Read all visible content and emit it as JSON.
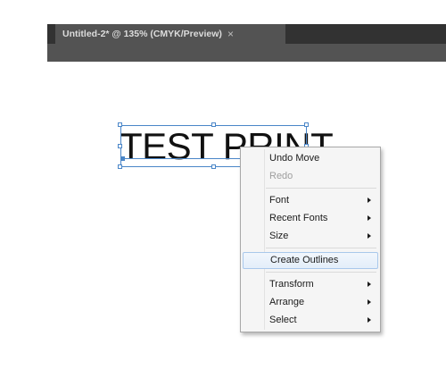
{
  "document_tab": {
    "title": "Untitled-2* @ 135% (CMYK/Preview)",
    "close_glyph": "×"
  },
  "canvas": {
    "text_object": "TEST PRINT"
  },
  "context_menu": {
    "items": [
      {
        "label": "Undo Move",
        "enabled": true,
        "submenu": false
      },
      {
        "label": "Redo",
        "enabled": false,
        "submenu": false
      },
      {
        "label": "Font",
        "enabled": true,
        "submenu": true
      },
      {
        "label": "Recent Fonts",
        "enabled": true,
        "submenu": true
      },
      {
        "label": "Size",
        "enabled": true,
        "submenu": true
      },
      {
        "label": "Create Outlines",
        "enabled": true,
        "submenu": false,
        "highlighted": true
      },
      {
        "label": "Transform",
        "enabled": true,
        "submenu": true
      },
      {
        "label": "Arrange",
        "enabled": true,
        "submenu": true
      },
      {
        "label": "Select",
        "enabled": true,
        "submenu": true
      }
    ]
  },
  "colors": {
    "tabstrip_bg": "#323232",
    "tab_bg": "#535353",
    "selection": "#4a86c8",
    "menu_highlight_border": "#a9c8eb"
  }
}
